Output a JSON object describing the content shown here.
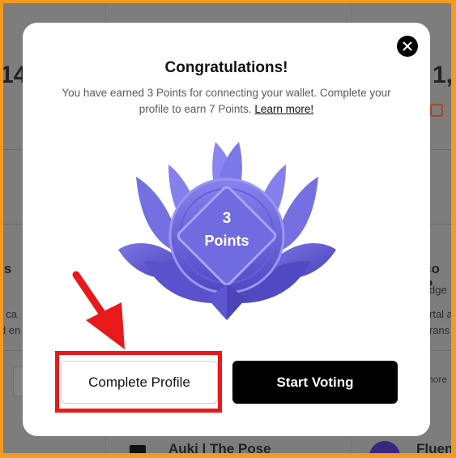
{
  "background": {
    "left_number": "14",
    "right_number": "1,",
    "left_heading": "ls",
    "left_line1": "ı ca",
    "left_line2": "d en",
    "right_heading": "co P",
    "right_line1": "dge",
    "right_line2": "rtal a",
    "right_line3": "rans",
    "right_more": "nore",
    "bottom_card_title": "Auki | The Pose",
    "bottom_card_title2": "Fluen"
  },
  "modal": {
    "title": "Congratulations!",
    "description": "You have earned 3 Points for connecting your wallet. Complete your profile to earn 7 Points. ",
    "learn_more": "Learn more!",
    "badge_value": "3",
    "badge_unit": "Points",
    "complete_profile_label": "Complete Profile",
    "start_voting_label": "Start Voting"
  },
  "colors": {
    "frame": "#f39a22",
    "badge": "#6b66d6",
    "highlight": "#e8191b",
    "primary_button": "#000000"
  },
  "icons": [
    "close-icon",
    "arrow-annotation",
    "badge-lotus"
  ]
}
